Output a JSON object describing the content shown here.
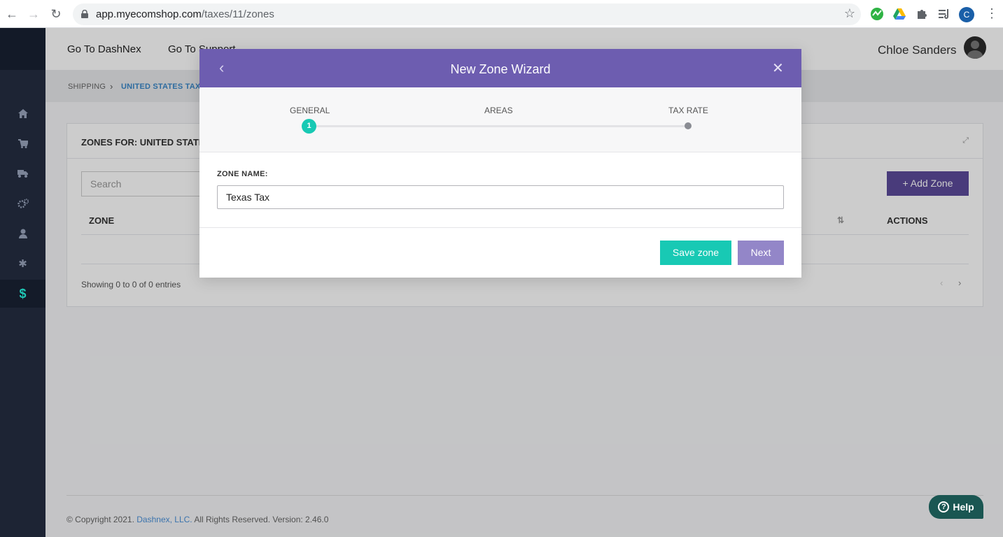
{
  "browser": {
    "url_host": "app.myecomshop.com",
    "url_path": "/taxes/11/zones",
    "profile_initial": "C"
  },
  "topbar": {
    "nav": [
      "Go To DashNex",
      "Go To Support"
    ],
    "user_name": "Chloe Sanders"
  },
  "sidebar": {
    "items": [
      {
        "icon": "home-icon",
        "glyph": "⌂"
      },
      {
        "icon": "cart-icon",
        "glyph": "🛒"
      },
      {
        "icon": "truck-icon",
        "glyph": "🚚"
      },
      {
        "icon": "gears-icon",
        "glyph": "⚙"
      },
      {
        "icon": "user-icon",
        "glyph": "👤"
      },
      {
        "icon": "asterisk-icon",
        "glyph": "✱"
      },
      {
        "icon": "dollar-icon",
        "glyph": "$"
      }
    ]
  },
  "breadcrumb": {
    "items": [
      "SHIPPING",
      "UNITED STATES TAX"
    ]
  },
  "panel": {
    "title": "ZONES FOR: UNITED STATES TAX",
    "search_placeholder": "Search",
    "add_button": "Add Zone",
    "columns": [
      "ZONE",
      "ACTIONS"
    ],
    "showing_text": "Showing 0 to 0 of 0 entries"
  },
  "footer": {
    "prefix": "© Copyright 2021.",
    "company": "Dashnex, LLC.",
    "suffix": "All Rights Reserved. Version: 2.46.0"
  },
  "help": {
    "label": "Help"
  },
  "modal": {
    "title": "New Zone Wizard",
    "steps": [
      "GENERAL",
      "AREAS",
      "TAX RATE"
    ],
    "current_step_number": "1",
    "field_label": "ZONE NAME:",
    "zone_name_value": "Texas Tax",
    "save_button": "Save zone",
    "next_button": "Next"
  },
  "colors": {
    "modal_header": "#6d5db0",
    "accent_teal": "#18c9b4",
    "sidebar": "#1d2434"
  }
}
